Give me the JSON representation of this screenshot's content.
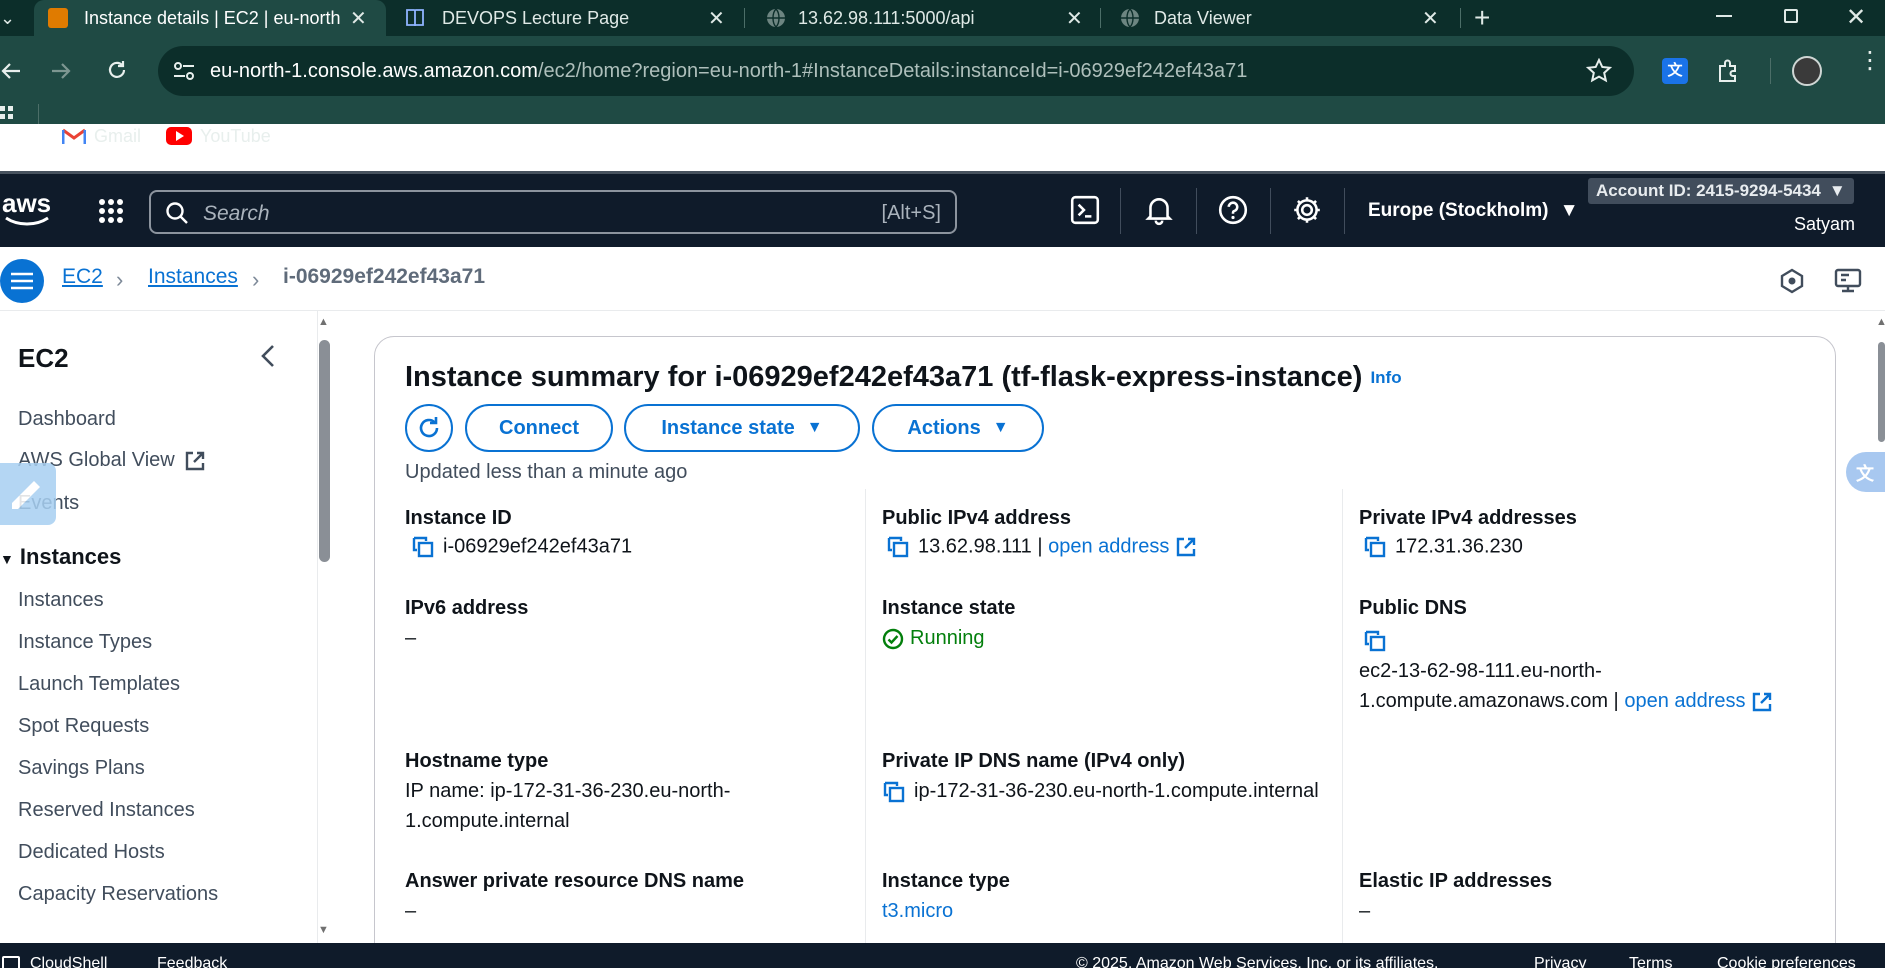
{
  "browser": {
    "tabs": [
      {
        "title": "Instance details | EC2 | eu-north",
        "active": true
      },
      {
        "title": "DEVOPS Lecture Page",
        "active": false
      },
      {
        "title": "13.62.98.111:5000/api",
        "active": false
      },
      {
        "title": "Data Viewer",
        "active": false
      }
    ],
    "new_tab": "+",
    "url_host": "eu-north-1.console.aws.amazon.com",
    "url_path": "/ec2/home?region=eu-north-1#InstanceDetails:instanceId=i-06929ef242ef43a71",
    "bookmarks": [
      {
        "label": "Gmail",
        "icon": "gmail-icon"
      },
      {
        "label": "YouTube",
        "icon": "youtube-icon"
      }
    ]
  },
  "aws_nav": {
    "logo": "aws",
    "search_placeholder": "Search",
    "search_shortcut": "[Alt+S]",
    "region": "Europe (Stockholm)",
    "account": "Account ID: 2415-9294-5434",
    "user": "Satyam"
  },
  "breadcrumb": {
    "items": [
      "EC2",
      "Instances",
      "i-06929ef242ef43a71"
    ]
  },
  "sidenav": {
    "title": "EC2",
    "items_top": [
      "Dashboard",
      "AWS Global View",
      "Events"
    ],
    "section": "Instances",
    "items_instances": [
      "Instances",
      "Instance Types",
      "Launch Templates",
      "Spot Requests",
      "Savings Plans",
      "Reserved Instances",
      "Dedicated Hosts",
      "Capacity Reservations"
    ]
  },
  "summary": {
    "title": "Instance summary for i-06929ef242ef43a71 (tf-flask-express-instance)",
    "info": "Info",
    "buttons": {
      "connect": "Connect",
      "instance_state": "Instance state",
      "actions": "Actions"
    },
    "updated": "Updated less than a minute ago",
    "fields": {
      "instance_id": {
        "label": "Instance ID",
        "value": "i-06929ef242ef43a71"
      },
      "public_ipv4": {
        "label": "Public IPv4 address",
        "value": "13.62.98.111 |",
        "link": "open address"
      },
      "private_ipv4": {
        "label": "Private IPv4 addresses",
        "value": "172.31.36.230"
      },
      "ipv6": {
        "label": "IPv6 address",
        "value": "–"
      },
      "instance_state": {
        "label": "Instance state",
        "value": "Running"
      },
      "public_dns": {
        "label": "Public DNS",
        "value": "ec2-13-62-98-111.eu-north-1.compute.amazonaws.com |",
        "link": "open address"
      },
      "hostname_type": {
        "label": "Hostname type",
        "value": "IP name: ip-172-31-36-230.eu-north-1.compute.internal"
      },
      "private_ip_dns": {
        "label": "Private IP DNS name (IPv4 only)",
        "value": "ip-172-31-36-230.eu-north-1.compute.internal"
      },
      "answer_dns": {
        "label": "Answer private resource DNS name",
        "value": "–"
      },
      "instance_type": {
        "label": "Instance type",
        "value": "t3.micro"
      },
      "elastic_ip": {
        "label": "Elastic IP addresses",
        "value": "–"
      }
    }
  },
  "footer": {
    "cloudshell": "CloudShell",
    "feedback": "Feedback",
    "copyright": "© 2025, Amazon Web Services, Inc. or its affiliates.",
    "privacy": "Privacy",
    "terms": "Terms",
    "cookie": "Cookie preferences"
  },
  "colors": {
    "chrome_dark": "#0c2e2a",
    "chrome_toolbar": "#1f4a44",
    "aws_nav": "#0f1b2a",
    "link_blue": "#0972d3",
    "running_green": "#037f0c"
  }
}
